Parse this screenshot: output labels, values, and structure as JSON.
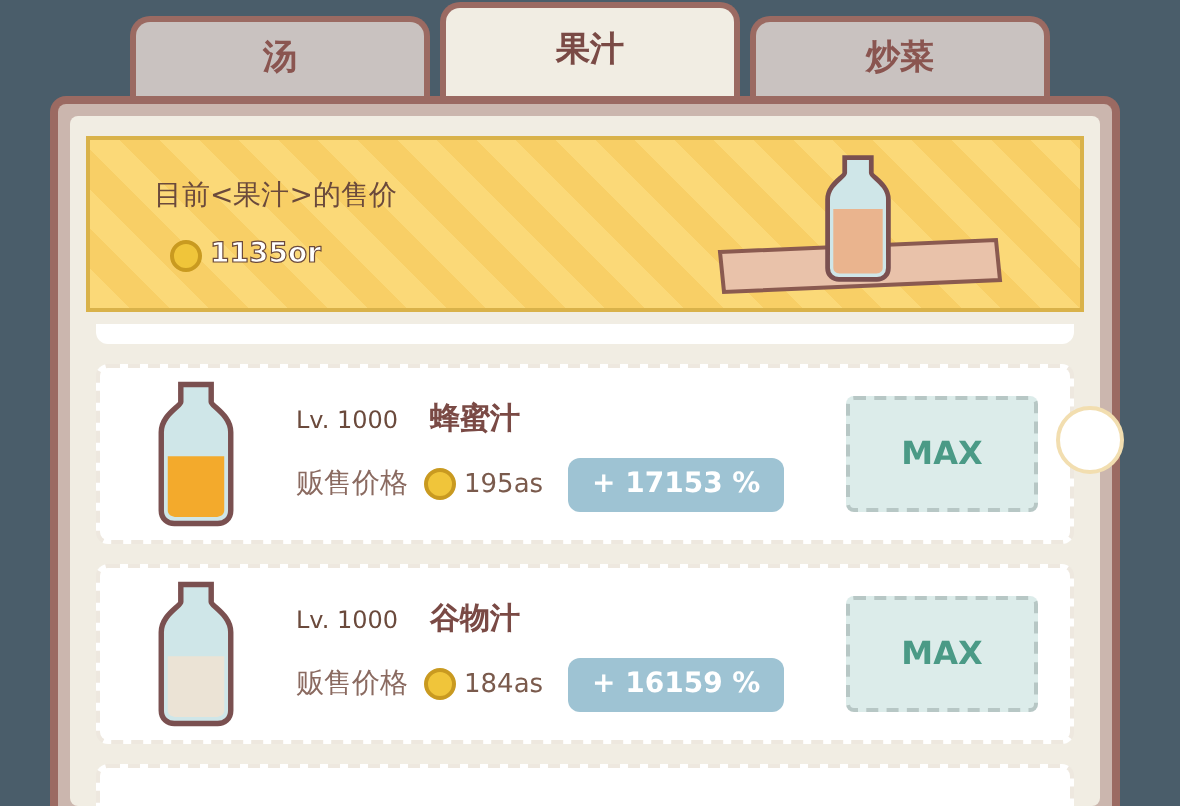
{
  "tabs": [
    {
      "label": "汤",
      "selected": false
    },
    {
      "label": "果汁",
      "selected": true
    },
    {
      "label": "炒菜",
      "selected": false
    }
  ],
  "banner": {
    "caption": "目前<果汁>的售价",
    "price": "1135or",
    "color": "#eab48e"
  },
  "items": [
    {
      "level": "Lv. 1000",
      "name": "蜂蜜汁",
      "price_label": "贩售价格",
      "price": "195as",
      "bonus": "+ 17153 %",
      "button": "MAX",
      "color": "#f3aa2c"
    },
    {
      "level": "Lv. 1000",
      "name": "谷物汁",
      "price_label": "贩售价格",
      "price": "184as",
      "bonus": "+ 16159 %",
      "button": "MAX",
      "color": "#ebe3d5"
    }
  ]
}
